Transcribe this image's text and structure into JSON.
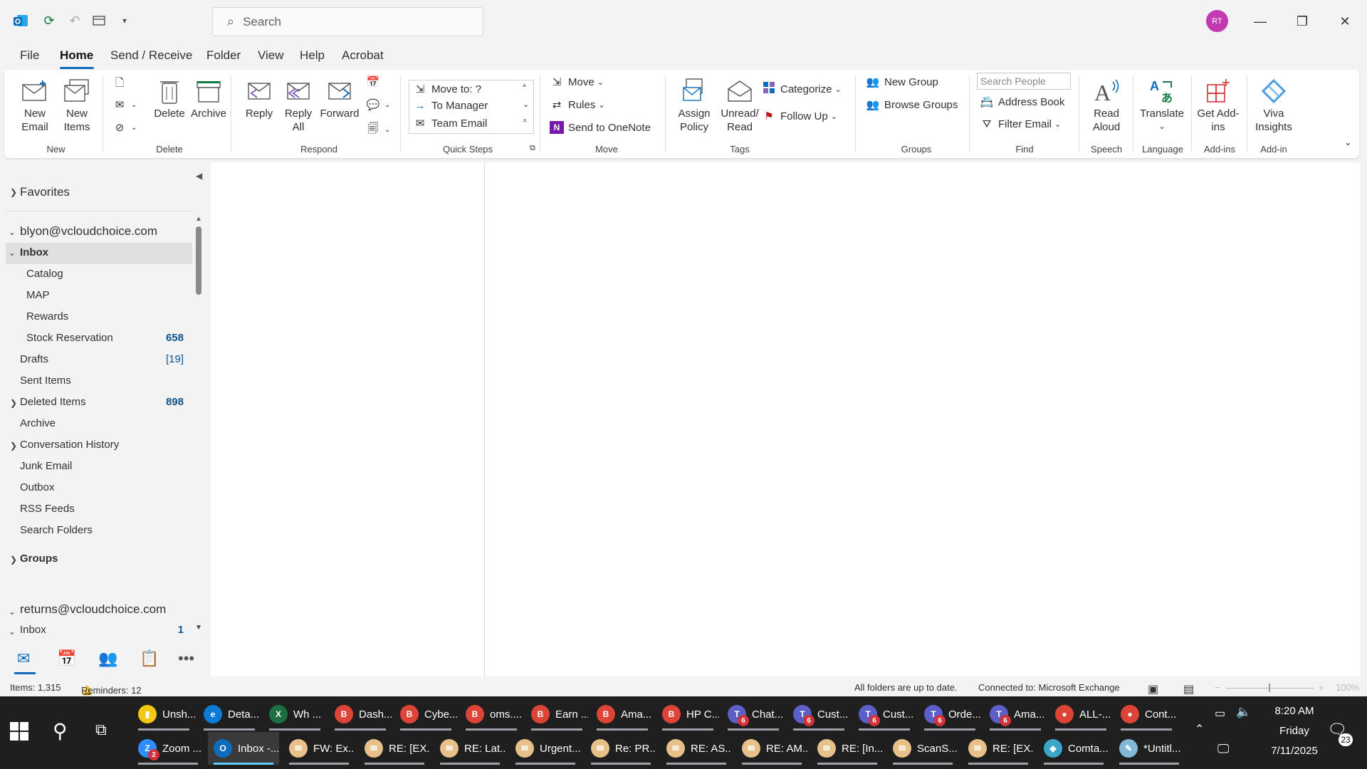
{
  "app": {
    "search_placeholder": "Search",
    "avatar_initials": "RT",
    "accent": "#0f6cbd"
  },
  "menu": {
    "tabs": [
      "File",
      "Home",
      "Send / Receive",
      "Folder",
      "View",
      "Help",
      "Acrobat"
    ],
    "active_tab": "Home"
  },
  "ribbon": {
    "new_email": "New Email",
    "new_items": "New Items",
    "group_new": "New",
    "delete": "Delete",
    "archive": "Archive",
    "group_delete": "Delete",
    "reply": "Reply",
    "reply_all": "Reply All",
    "forward": "Forward",
    "group_respond": "Respond",
    "quick_steps": [
      "Move to: ?",
      "To Manager",
      "Team Email"
    ],
    "group_quick_steps": "Quick Steps",
    "move": "Move",
    "rules": "Rules",
    "send_onenote": "Send to OneNote",
    "group_move": "Move",
    "assign_policy": "Assign Policy",
    "unread_read": "Unread/ Read",
    "categorize": "Categorize",
    "follow_up": "Follow Up",
    "group_tags": "Tags",
    "new_group": "New Group",
    "browse_groups": "Browse Groups",
    "group_groups": "Groups",
    "search_people": "Search People",
    "address_book": "Address Book",
    "filter_email": "Filter Email",
    "group_find": "Find",
    "read_aloud": "Read Aloud",
    "group_speech": "Speech",
    "translate": "Translate",
    "group_language": "Language",
    "get_addins": "Get Add-ins",
    "group_addins": "Add-ins",
    "viva_insights": "Viva Insights",
    "group_addin": "Add-in"
  },
  "folders": {
    "favorites": "Favorites",
    "account1": "blyon@vcloudchoice.com",
    "inbox": "Inbox",
    "catalog": "Catalog",
    "map": "MAP",
    "rewards": "Rewards",
    "stock_reservation": "Stock Reservation",
    "stock_reservation_count": "658",
    "drafts": "Drafts",
    "drafts_count": "[19]",
    "sent": "Sent Items",
    "deleted": "Deleted Items",
    "deleted_count": "898",
    "archive": "Archive",
    "conversation_history": "Conversation History",
    "junk": "Junk Email",
    "outbox": "Outbox",
    "rss": "RSS Feeds",
    "search_folders": "Search Folders",
    "groups": "Groups",
    "account2": "returns@vcloudchoice.com",
    "inbox2": "Inbox",
    "inbox2_count": "1"
  },
  "status": {
    "items": "Items: 1,315",
    "reminders": "Reminders: 12",
    "sync": "All folders are up to date.",
    "connection": "Connected to: Microsoft Exchange",
    "zoom": "100%"
  },
  "taskbar": {
    "row1": [
      {
        "label": "Unsh...",
        "color": "#f2c811",
        "glyph": "▮"
      },
      {
        "label": "Deta...",
        "color": "#0b7bd6",
        "glyph": "e"
      },
      {
        "label": "Wh ...",
        "color": "#1d6f42",
        "glyph": "X"
      },
      {
        "label": "Dash...",
        "color": "#db4437",
        "glyph": "B"
      },
      {
        "label": "Cybe...",
        "color": "#db4437",
        "glyph": "B"
      },
      {
        "label": "oms....",
        "color": "#db4437",
        "glyph": "B"
      },
      {
        "label": "Earn ...",
        "color": "#db4437",
        "glyph": "B"
      },
      {
        "label": "Ama...",
        "color": "#db4437",
        "glyph": "B"
      },
      {
        "label": "HP C...",
        "color": "#db4437",
        "glyph": "B"
      },
      {
        "label": "Chat...",
        "color": "#5b5fc7",
        "glyph": "T",
        "badge": "6"
      },
      {
        "label": "Cust...",
        "color": "#5b5fc7",
        "glyph": "T",
        "badge": "6"
      },
      {
        "label": "Cust...",
        "color": "#5b5fc7",
        "glyph": "T",
        "badge": "6"
      },
      {
        "label": "Orde...",
        "color": "#5b5fc7",
        "glyph": "T",
        "badge": "6"
      },
      {
        "label": "Ama...",
        "color": "#5b5fc7",
        "glyph": "T",
        "badge": "6"
      },
      {
        "label": "ALL-...",
        "color": "#db4437",
        "glyph": "●"
      },
      {
        "label": "Cont...",
        "color": "#db4437",
        "glyph": "●"
      }
    ],
    "row2": [
      {
        "label": "Zoom ...",
        "color": "#2d8cff",
        "glyph": "Z",
        "badge": "2"
      },
      {
        "label": "Inbox -...",
        "color": "#0f6cbd",
        "glyph": "O",
        "active": true
      },
      {
        "label": "FW: Ex...",
        "color": "#e8c08a",
        "glyph": "✉"
      },
      {
        "label": "RE: [EX...",
        "color": "#e8c08a",
        "glyph": "✉"
      },
      {
        "label": "RE: Lat...",
        "color": "#e8c08a",
        "glyph": "✉"
      },
      {
        "label": "Urgent...",
        "color": "#e8c08a",
        "glyph": "✉"
      },
      {
        "label": "Re: PR...",
        "color": "#e8c08a",
        "glyph": "✉"
      },
      {
        "label": "RE: AS...",
        "color": "#e8c08a",
        "glyph": "✉"
      },
      {
        "label": "RE: AM...",
        "color": "#e8c08a",
        "glyph": "✉"
      },
      {
        "label": "RE: [In...",
        "color": "#e8c08a",
        "glyph": "✉"
      },
      {
        "label": "ScanS...",
        "color": "#e8c08a",
        "glyph": "✉"
      },
      {
        "label": "RE: [EX...",
        "color": "#e8c08a",
        "glyph": "✉"
      },
      {
        "label": "Comta...",
        "color": "#3aa6c9",
        "glyph": "◆"
      },
      {
        "label": "*Untitl...",
        "color": "#7fb8d8",
        "glyph": "✎"
      }
    ],
    "time": "8:20 AM",
    "day": "Friday",
    "date": "7/11/2025",
    "notif_count": "23"
  }
}
